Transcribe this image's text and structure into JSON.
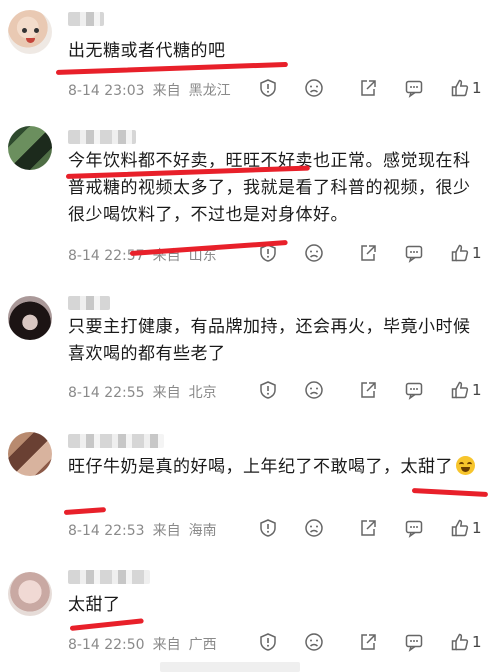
{
  "comments": [
    {
      "text": "出无糖或者代糖的吧",
      "date": "8-14 23:03",
      "source": "来自",
      "location": "黑龙江",
      "likes": "1"
    },
    {
      "text": "今年饮料都不好卖，旺旺不好卖也正常。感觉现在科普戒糖的视频太多了，我就是看了科普的视频，很少很少喝饮料了，不过也是对身体好。",
      "date": "8-14 22:57",
      "source": "来自",
      "location": "山东",
      "likes": "1"
    },
    {
      "text": "只要主打健康，有品牌加持，还会再火，毕竟小时候喜欢喝的都有些老了",
      "date": "8-14 22:55",
      "source": "来自",
      "location": "北京",
      "likes": "1"
    },
    {
      "text": "旺仔牛奶是真的好喝，上年纪了不敢喝了，太甜了",
      "date": "8-14 22:53",
      "source": "来自",
      "location": "海南",
      "likes": "1"
    },
    {
      "text": "太甜了",
      "date": "8-14 22:50",
      "source": "来自",
      "location": "广西",
      "likes": "1"
    }
  ],
  "icons": [
    "report-icon",
    "dislike-icon",
    "share-icon",
    "reply-icon",
    "like-icon"
  ],
  "colors": {
    "highlight": "#e8202a",
    "meta": "#8a8a8a"
  }
}
